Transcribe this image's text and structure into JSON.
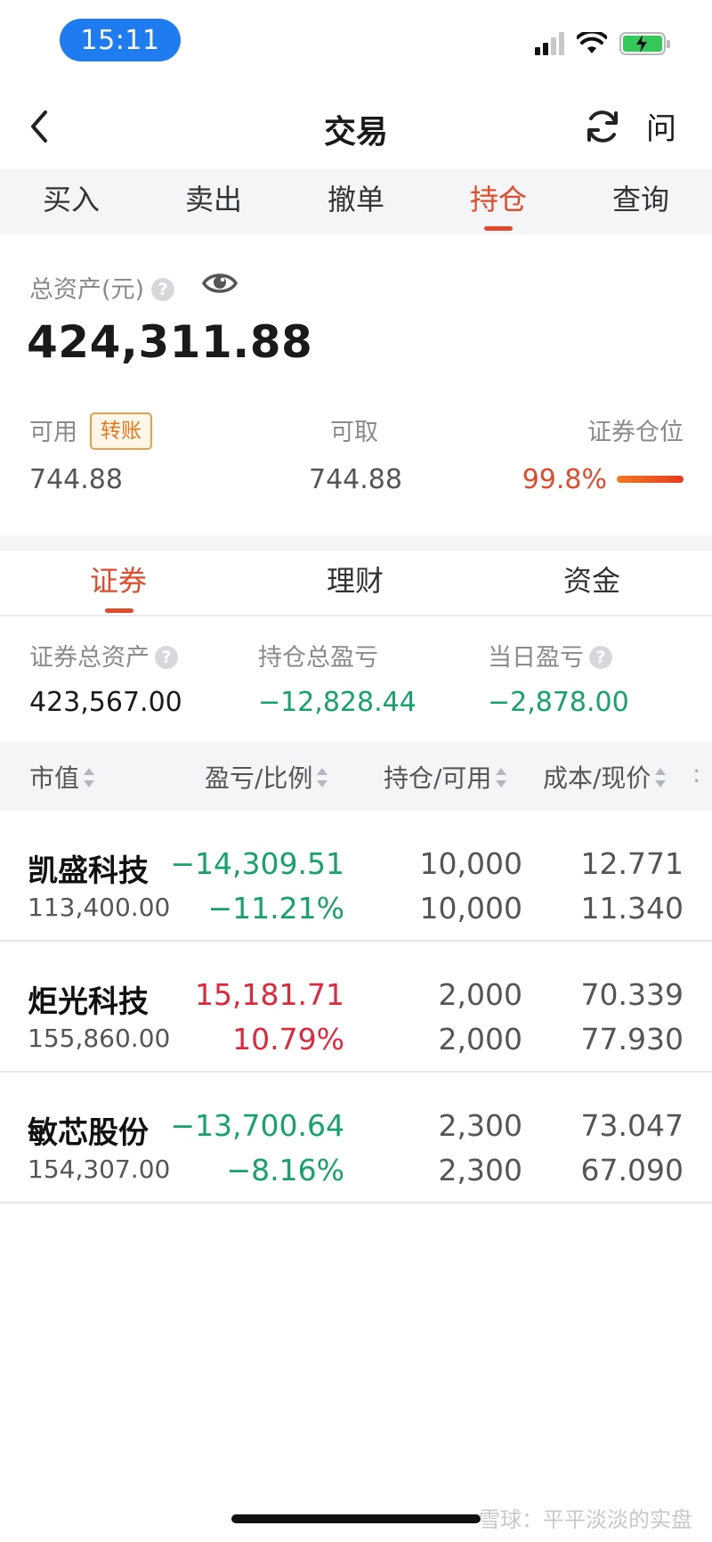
{
  "status_bar": {
    "time": "15:11"
  },
  "header": {
    "title": "交易",
    "help_label": "问"
  },
  "top_tabs": [
    {
      "label": "买入"
    },
    {
      "label": "卖出"
    },
    {
      "label": "撤单"
    },
    {
      "label": "持仓",
      "active": true
    },
    {
      "label": "查询"
    }
  ],
  "assets": {
    "total_label": "总资产(元)",
    "total_value": "424,311.88",
    "available_label": "可用",
    "transfer_button": "转账",
    "available_value": "744.88",
    "withdrawable_label": "可取",
    "withdrawable_value": "744.88",
    "position_label": "证券仓位",
    "position_value": "99.8%",
    "position_ratio": 0.998
  },
  "mid_tabs": [
    {
      "label": "证券",
      "active": true
    },
    {
      "label": "理财"
    },
    {
      "label": "资金"
    }
  ],
  "summary": {
    "securities_total_label": "证券总资产",
    "securities_total_value": "423,567.00",
    "holding_pl_label": "持仓总盈亏",
    "holding_pl_value": "−12,828.44",
    "daily_pl_label": "当日盈亏",
    "daily_pl_value": "−2,878.00"
  },
  "table": {
    "headers": {
      "market_value": "市值",
      "pl_ratio": "盈亏/比例",
      "holding_available": "持仓/可用",
      "cost_price": "成本/现价",
      "more": ":"
    },
    "rows": [
      {
        "name": "凯盛科技",
        "market_value": "113,400.00",
        "pl": "−14,309.51",
        "pl_pct": "−11.21%",
        "holding": "10,000",
        "available": "10,000",
        "cost": "12.771",
        "price": "11.340",
        "trend": "down"
      },
      {
        "name": "炬光科技",
        "market_value": "155,860.00",
        "pl": "15,181.71",
        "pl_pct": "10.79%",
        "holding": "2,000",
        "available": "2,000",
        "cost": "70.339",
        "price": "77.930",
        "trend": "up"
      },
      {
        "name": "敏芯股份",
        "market_value": "154,307.00",
        "pl": "−13,700.64",
        "pl_pct": "−8.16%",
        "holding": "2,300",
        "available": "2,300",
        "cost": "73.047",
        "price": "67.090",
        "trend": "down"
      }
    ]
  },
  "watermark": "雪球：平平淡淡的实盘",
  "colors": {
    "accent": "#e14a2a",
    "gain": "#e0283c",
    "loss": "#14a36a",
    "time_pill": "#1e7cf0"
  }
}
